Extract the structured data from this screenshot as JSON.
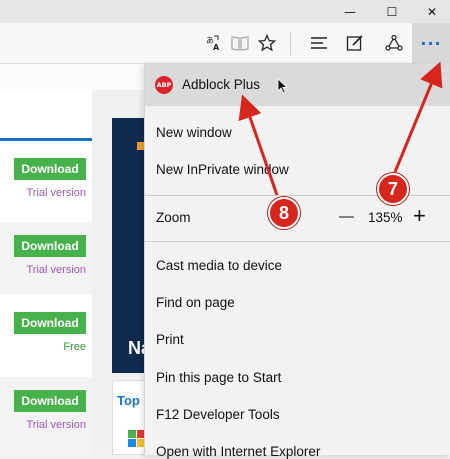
{
  "window": {
    "minimize_glyph": "—",
    "maximize_glyph": "☐",
    "close_glyph": "✕"
  },
  "toolbar": {
    "icons": [
      "translate-icon",
      "reading-view-icon",
      "favorites-star-icon",
      "hub-icon",
      "web-note-icon",
      "share-icon",
      "more-actions-icon"
    ],
    "more_glyph": "···"
  },
  "downloads": [
    {
      "button": "Download",
      "note": "Trial version",
      "note_color": "#9b59b6"
    },
    {
      "button": "Download",
      "note": "Trial version",
      "note_color": "#9b59b6"
    },
    {
      "button": "Download",
      "note": "Free",
      "note_color": "#2e9e3e"
    },
    {
      "button": "Download",
      "note": "Trial version",
      "note_color": "#9b59b6"
    }
  ],
  "page": {
    "banner_text": "Na",
    "top_label": "Top"
  },
  "menu": {
    "extension": {
      "icon_text": "ABP",
      "label": "Adblock Plus"
    },
    "new_window": "New window",
    "new_inprivate": "New InPrivate window",
    "zoom": {
      "label": "Zoom",
      "minus": "—",
      "value": "135%",
      "plus": "+"
    },
    "cast": "Cast media to device",
    "find": "Find on page",
    "print": "Print",
    "pin": "Pin this page to Start",
    "devtools": "F12 Developer Tools",
    "open_ie": "Open with Internet Explorer"
  },
  "annotations": {
    "callout_8": "8",
    "callout_7": "7",
    "arrow_color": "#d7261e"
  }
}
